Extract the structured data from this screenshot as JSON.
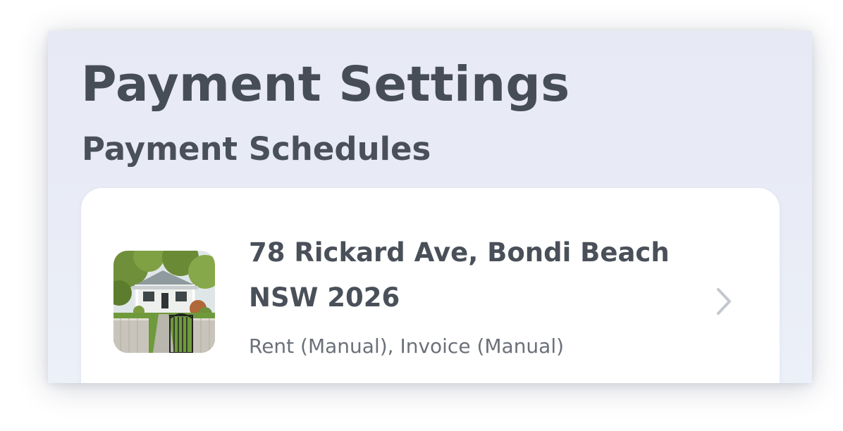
{
  "page": {
    "title": "Payment Settings",
    "section_title": "Payment Schedules"
  },
  "property_card": {
    "address_line1": "78 Rickard Ave, Bondi Beach",
    "address_line2": "NSW 2026",
    "schedule_types": "Rent (Manual), Invoice (Manual)",
    "thumbnail": "house-photo",
    "action_icon": "chevron-right-icon"
  },
  "colors": {
    "background": "#e8ebf6",
    "card": "#ffffff",
    "heading_text": "#474d57",
    "secondary_text": "#6b7079",
    "chevron": "#c4c7cf"
  }
}
